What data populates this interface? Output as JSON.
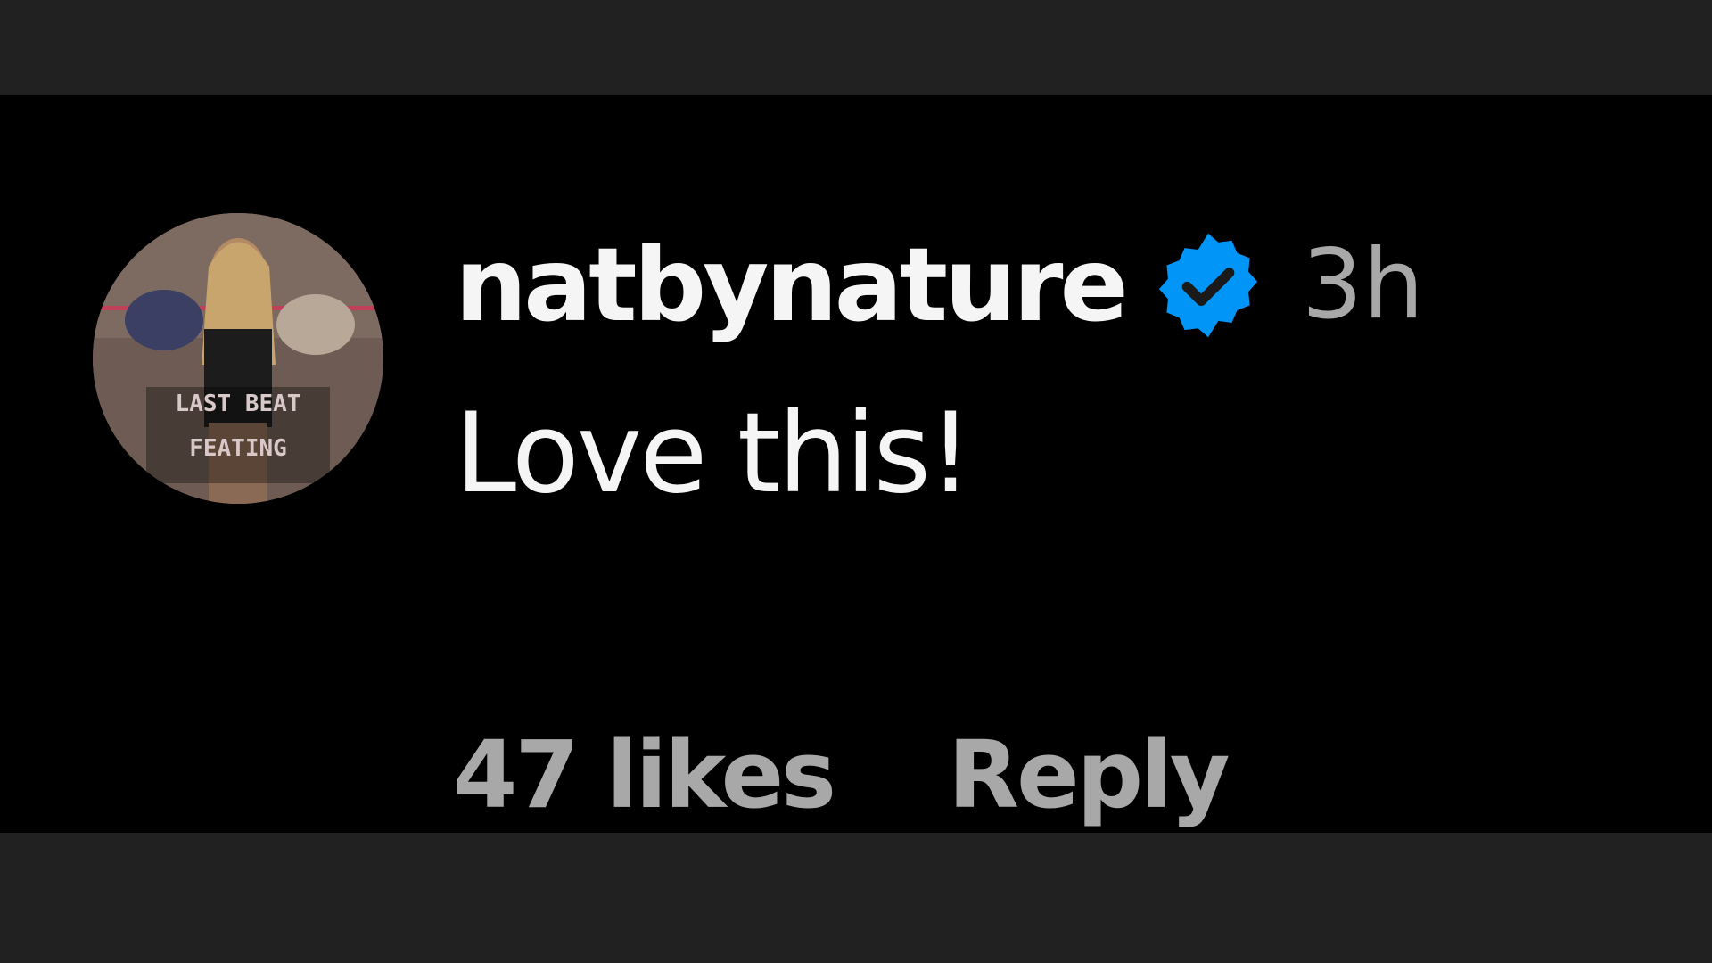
{
  "comment": {
    "username": "natbynature",
    "verified_icon": "verified-badge-icon",
    "timestamp": "3h",
    "text": "Love this!",
    "likes_label": "47 likes",
    "reply_label": "Reply",
    "avatar_text_line1": "LAST BEAT",
    "avatar_text_line2": "FEATING"
  },
  "colors": {
    "panel_background": "#000000",
    "letterbox": "#212121",
    "primary_text": "#f5f5f5",
    "secondary_text": "#a8a8a8",
    "verified_blue": "#0095f6"
  }
}
